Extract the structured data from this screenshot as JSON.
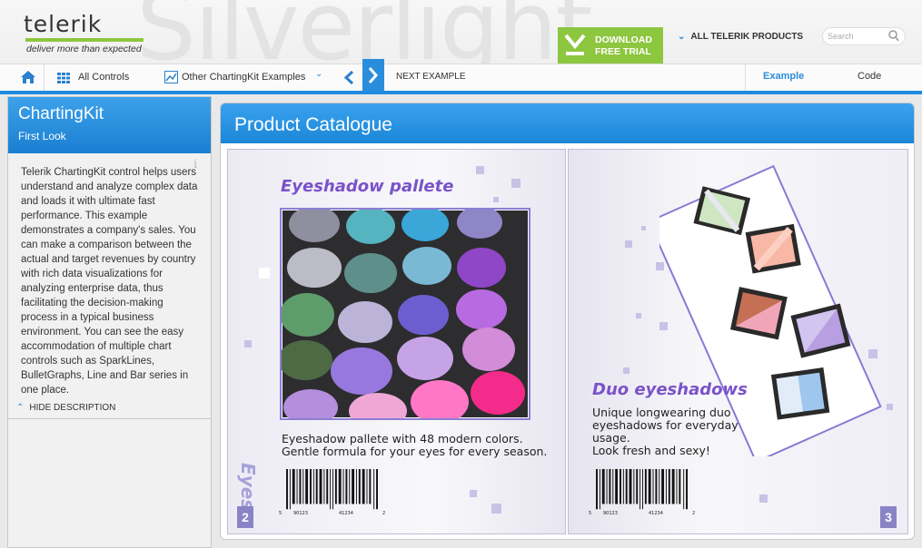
{
  "header": {
    "watermark": "Silverlight",
    "logo_text": "telerik",
    "tagline": "deliver more than expected",
    "download_line1": "DOWNLOAD",
    "download_line2": "FREE TRIAL",
    "all_products": "ALL TELERIK PRODUCTS",
    "search_placeholder": "Search"
  },
  "nav": {
    "all_controls": "All Controls",
    "other_examples": "Other ChartingKit Examples",
    "next_example": "NEXT EXAMPLE",
    "tab_example": "Example",
    "tab_code": "Code"
  },
  "sidebar": {
    "title": "ChartingKit",
    "subtitle": "First Look",
    "description": "Telerik ChartingKit control helps users understand and analyze complex data and loads it with ultimate fast performance. This example demonstrates a company's sales. You can make a comparison between the actual and target revenues by country with rich data visualizations for analyzing enterprise data, thus facilitating the decision-making process in a typical business environment. You can see the easy accommodation of multiple chart controls such as SparkLines, BulletGraphs, Line and Bar series in one place.",
    "hide_description": "HIDE DESCRIPTION"
  },
  "main": {
    "title": "Product Catalogue",
    "left_page": {
      "heading": "Eyeshadow pallete",
      "text_line1": "Eyeshadow pallete with 48 modern colors.",
      "text_line2": "Gentle formula for your eyes for every season.",
      "category": "Eyes",
      "page_number": "2",
      "barcode_left": "5",
      "barcode_mid1": "90123",
      "barcode_mid2": "41234",
      "barcode_right": "2"
    },
    "right_page": {
      "heading": "Duo eyeshadows",
      "text_line1": "Unique longwearing duo",
      "text_line2": "eyeshadows for everyday",
      "text_line3": "usage.",
      "text_line4": "Look fresh and sexy!",
      "page_number": "3",
      "barcode_left": "5",
      "barcode_mid1": "90123",
      "barcode_mid2": "41234",
      "barcode_right": "2"
    }
  },
  "colors": {
    "accent_blue": "#1f8ae0",
    "trial_green": "#8dc63f",
    "catalogue_purple": "#7a52c9"
  }
}
